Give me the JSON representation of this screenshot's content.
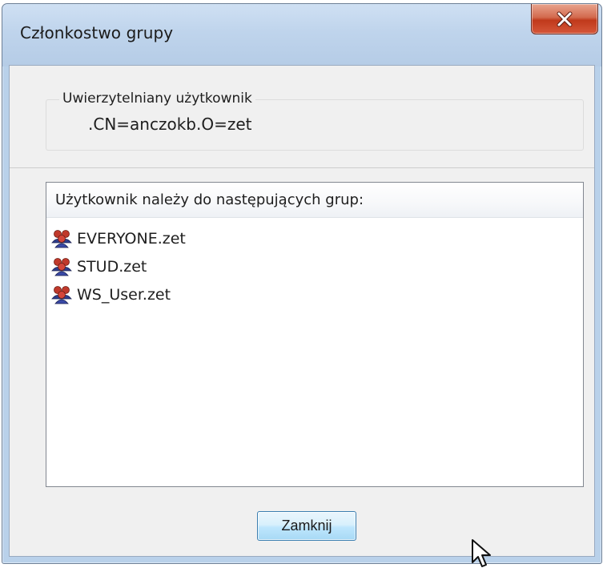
{
  "window": {
    "title": "Członkostwo grupy"
  },
  "authenticated_user": {
    "legend": "Uwierzytelniany użytkownik",
    "value": ".CN=anczokb.O=zet"
  },
  "groups_list": {
    "header": "Użytkownik należy do następujących grup:",
    "items": [
      {
        "label": "EVERYONE.zet",
        "icon": "group-icon"
      },
      {
        "label": "STUD.zet",
        "icon": "group-icon"
      },
      {
        "label": "WS_User.zet",
        "icon": "group-icon"
      }
    ]
  },
  "buttons": {
    "close_label": "Zamknij"
  },
  "colors": {
    "title_bar": "#bfd4ec",
    "close_red": "#c0391b",
    "button_blue": "#bee6fd",
    "client_background": "#f0f0f0"
  }
}
